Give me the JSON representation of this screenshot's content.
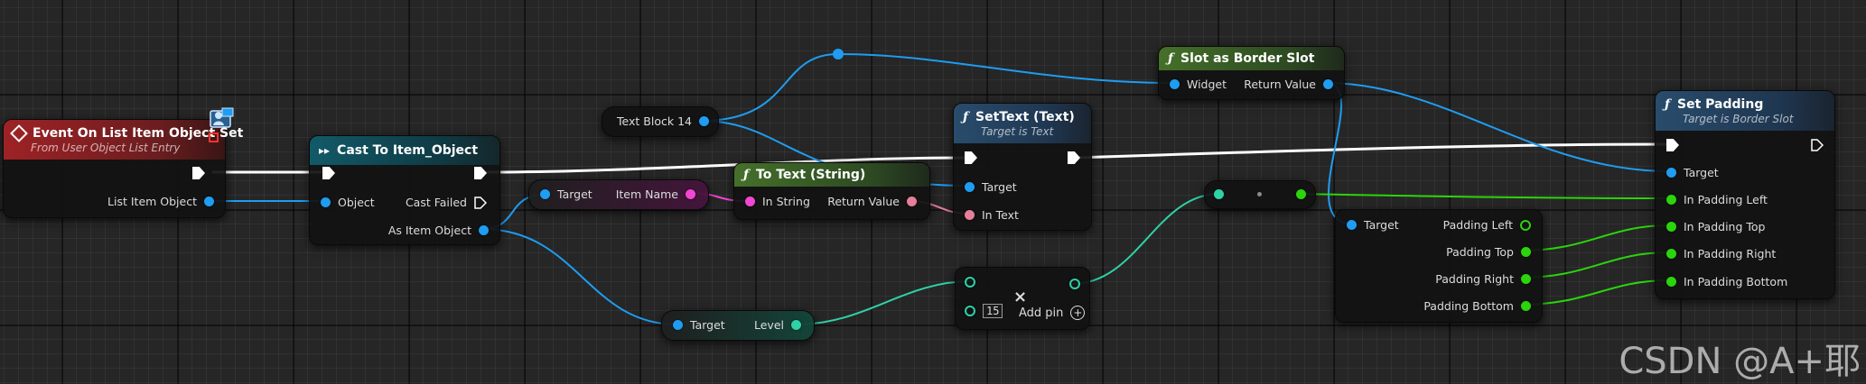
{
  "colors": {
    "exec": "#ffffff",
    "object": "#1e9df2",
    "string": "#f246d4",
    "text": "#e57f9b",
    "integer": "#2fd1a7",
    "float": "#2bd40c",
    "event_header": "#9e2225",
    "cast_header": "#125a68",
    "function_header": "#294c6c",
    "pure_function_header": "#45702a"
  },
  "nodes": {
    "event": {
      "title": "Event On List Item Object Set",
      "subtitle": "From User Object List Entry",
      "pin_list_item_object": "List Item Object"
    },
    "cast": {
      "title": "Cast To Item_Object",
      "pin_object": "Object",
      "pin_cast_failed": "Cast Failed",
      "pin_as_item_object": "As Item Object"
    },
    "text_block_var": {
      "label": "Text Block 14"
    },
    "item_name_get": {
      "pin_target": "Target",
      "pin_item_name": "Item Name"
    },
    "to_text": {
      "title": "To Text (String)",
      "pin_in_string": "In String",
      "pin_return_value": "Return Value"
    },
    "set_text": {
      "title": "SetText (Text)",
      "subtitle": "Target is Text",
      "pin_target": "Target",
      "pin_in_text": "In Text"
    },
    "slot_as_border": {
      "title": "Slot as Border Slot",
      "pin_widget": "Widget",
      "pin_return_value": "Return Value"
    },
    "level_get": {
      "pin_target": "Target",
      "pin_level": "Level"
    },
    "multiply": {
      "add_pin_label": "Add pin",
      "constant": "15",
      "op": "×"
    },
    "break_padding": {
      "pin_target": "Target",
      "pin_left": "Padding Left",
      "pin_top": "Padding Top",
      "pin_right": "Padding Right",
      "pin_bottom": "Padding Bottom"
    },
    "set_padding": {
      "title": "Set Padding",
      "subtitle": "Target is Border Slot",
      "pin_target": "Target",
      "pin_in_left": "In Padding Left",
      "pin_in_top": "In Padding Top",
      "pin_in_right": "In Padding Right",
      "pin_in_bottom": "In Padding Bottom"
    }
  },
  "icons": {
    "function": "f",
    "cast": "cast-arrows-icon",
    "event": "event-diamond-icon",
    "user_widget_badge": "user-widget-icon"
  },
  "watermark": "CSDN @A+耶"
}
